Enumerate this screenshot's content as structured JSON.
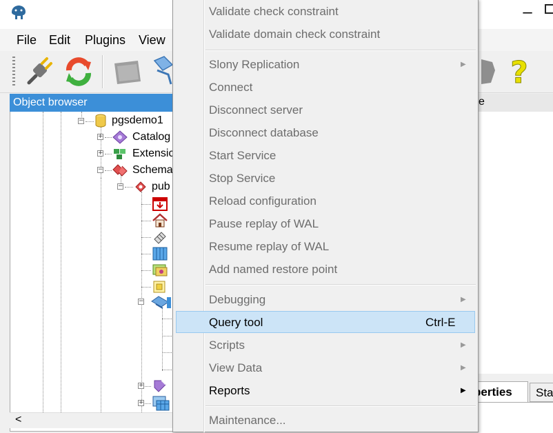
{
  "menubar": {
    "items": [
      "File",
      "Edit",
      "Plugins",
      "View"
    ]
  },
  "object_browser": {
    "title": "Object browser",
    "tree": {
      "database": "pgsdemo1",
      "catalogs": "Catalog",
      "extensions": "Extensic",
      "schemas": "Schema",
      "public": "pub"
    },
    "scroll_left": "<"
  },
  "right_panel": {
    "header_fragment": "e",
    "tab_properties": "perties",
    "tab_statistics": "Sta"
  },
  "context_menu": {
    "items": [
      {
        "label": "Validate check constraint",
        "enabled": false
      },
      {
        "label": "Validate domain check constraint",
        "enabled": false
      },
      {
        "label": "Slony Replication",
        "enabled": false,
        "submenu": true
      },
      {
        "label": "Connect",
        "enabled": false
      },
      {
        "label": "Disconnect server",
        "enabled": false
      },
      {
        "label": "Disconnect database",
        "enabled": false
      },
      {
        "label": "Start Service",
        "enabled": false
      },
      {
        "label": "Stop Service",
        "enabled": false
      },
      {
        "label": "Reload configuration",
        "enabled": false
      },
      {
        "label": "Pause replay of WAL",
        "enabled": false
      },
      {
        "label": "Resume replay of WAL",
        "enabled": false
      },
      {
        "label": "Add named restore point",
        "enabled": false
      },
      {
        "label": "Debugging",
        "enabled": false,
        "submenu": true
      },
      {
        "label": "Query tool",
        "enabled": true,
        "shortcut": "Ctrl-E",
        "highlighted": true
      },
      {
        "label": "Scripts",
        "enabled": false,
        "submenu": true
      },
      {
        "label": "View Data",
        "enabled": false,
        "submenu": true
      },
      {
        "label": "Reports",
        "enabled": true,
        "submenu": true
      },
      {
        "label": "Maintenance...",
        "enabled": false
      }
    ]
  },
  "icons": {
    "app": "elephant-icon",
    "connect": "plug-icon",
    "refresh": "refresh-icon",
    "help": "help-icon"
  },
  "colors": {
    "highlight": "#cce4f7",
    "highlight_border": "#99c9ef",
    "object_browser_header": "#3c8fd8",
    "disabled_text": "#6d6d6d"
  }
}
